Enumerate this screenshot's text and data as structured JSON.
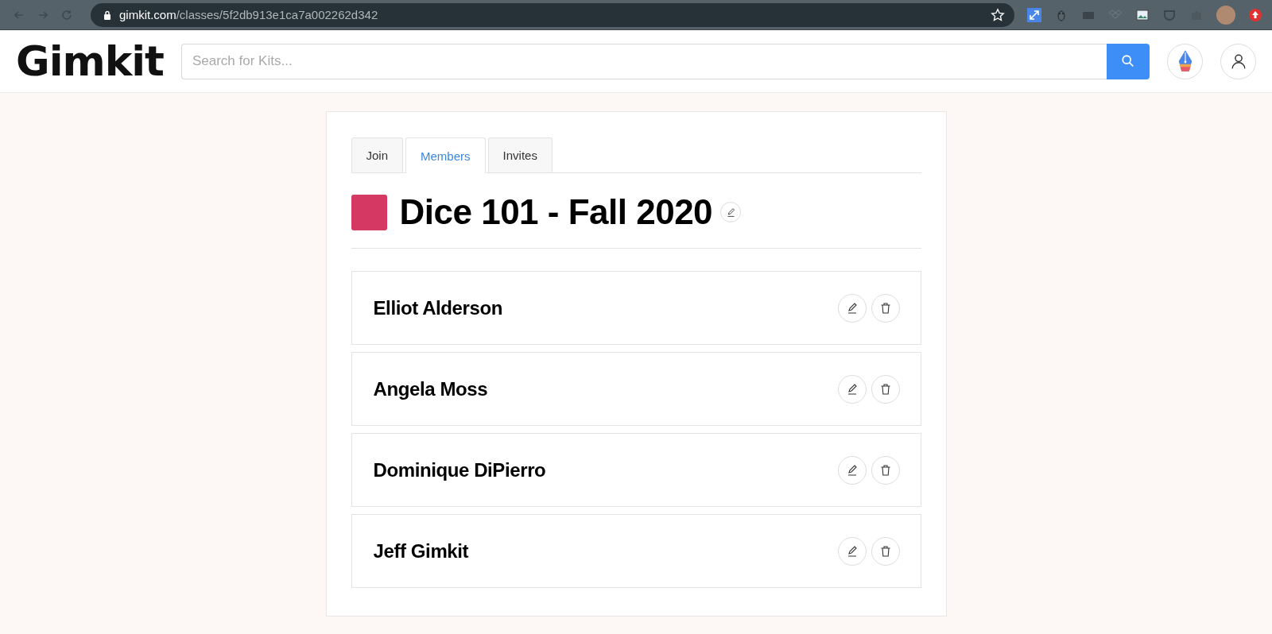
{
  "browser": {
    "url_host": "gimkit.com",
    "url_path": "/classes/5f2db913e1ca7a002262d342"
  },
  "header": {
    "logo": "Gimkit",
    "search": {
      "placeholder": "Search for Kits..."
    }
  },
  "tabs": [
    {
      "label": "Join",
      "selected": false
    },
    {
      "label": "Members",
      "selected": true
    },
    {
      "label": "Invites",
      "selected": false
    }
  ],
  "class": {
    "title": "Dice 101 - Fall 2020",
    "color": "#d63864"
  },
  "members": [
    {
      "name": "Elliot Alderson"
    },
    {
      "name": "Angela Moss"
    },
    {
      "name": "Dominique DiPierro"
    },
    {
      "name": "Jeff Gimkit"
    }
  ]
}
